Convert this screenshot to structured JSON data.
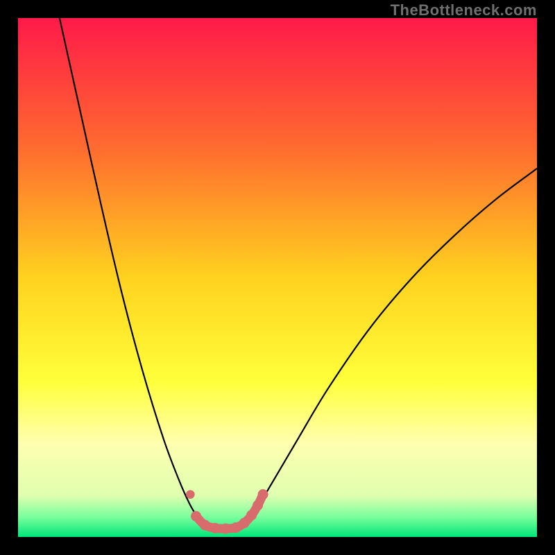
{
  "watermark": "TheBottleneck.com",
  "chart_data": {
    "type": "line",
    "title": "",
    "xlabel": "",
    "ylabel": "",
    "xlim": [
      0,
      100
    ],
    "ylim": [
      0,
      100
    ],
    "background_gradient": {
      "stops": [
        {
          "offset": 0.0,
          "color": "#ff1a49"
        },
        {
          "offset": 0.25,
          "color": "#ff6b2f"
        },
        {
          "offset": 0.5,
          "color": "#ffd21f"
        },
        {
          "offset": 0.7,
          "color": "#ffff3a"
        },
        {
          "offset": 0.82,
          "color": "#ffffb0"
        },
        {
          "offset": 0.92,
          "color": "#dfffaf"
        },
        {
          "offset": 0.96,
          "color": "#7fff9e"
        },
        {
          "offset": 1.0,
          "color": "#00e67a"
        }
      ]
    },
    "series": [
      {
        "name": "bottleneck-curve",
        "color": "#000000",
        "width": 2.2,
        "points": [
          {
            "x": 8.0,
            "y": 100.0
          },
          {
            "x": 12.0,
            "y": 82.0
          },
          {
            "x": 16.0,
            "y": 64.0
          },
          {
            "x": 20.0,
            "y": 47.0
          },
          {
            "x": 24.0,
            "y": 32.0
          },
          {
            "x": 28.0,
            "y": 19.0
          },
          {
            "x": 31.0,
            "y": 11.0
          },
          {
            "x": 33.0,
            "y": 6.5
          },
          {
            "x": 34.5,
            "y": 4.0
          },
          {
            "x": 36.0,
            "y": 2.5
          },
          {
            "x": 38.0,
            "y": 1.8
          },
          {
            "x": 40.0,
            "y": 1.6
          },
          {
            "x": 42.0,
            "y": 1.8
          },
          {
            "x": 44.0,
            "y": 3.0
          },
          {
            "x": 46.0,
            "y": 5.5
          },
          {
            "x": 49.0,
            "y": 10.5
          },
          {
            "x": 54.0,
            "y": 19.0
          },
          {
            "x": 60.0,
            "y": 29.0
          },
          {
            "x": 68.0,
            "y": 40.5
          },
          {
            "x": 76.0,
            "y": 50.0
          },
          {
            "x": 84.0,
            "y": 58.0
          },
          {
            "x": 92.0,
            "y": 65.0
          },
          {
            "x": 100.0,
            "y": 71.0
          }
        ]
      },
      {
        "name": "highlight-dots",
        "color": "#d86b6b",
        "radius": 9,
        "stroke_main": 13,
        "points": [
          {
            "x": 33.2,
            "y": 8.2
          },
          {
            "x": 34.3,
            "y": 4.0
          },
          {
            "x": 36.0,
            "y": 2.3
          },
          {
            "x": 38.0,
            "y": 1.7
          },
          {
            "x": 40.0,
            "y": 1.6
          },
          {
            "x": 42.0,
            "y": 1.8
          },
          {
            "x": 43.6,
            "y": 2.7
          },
          {
            "x": 45.0,
            "y": 4.2
          },
          {
            "x": 46.2,
            "y": 6.1
          },
          {
            "x": 47.2,
            "y": 8.2
          }
        ]
      }
    ]
  }
}
